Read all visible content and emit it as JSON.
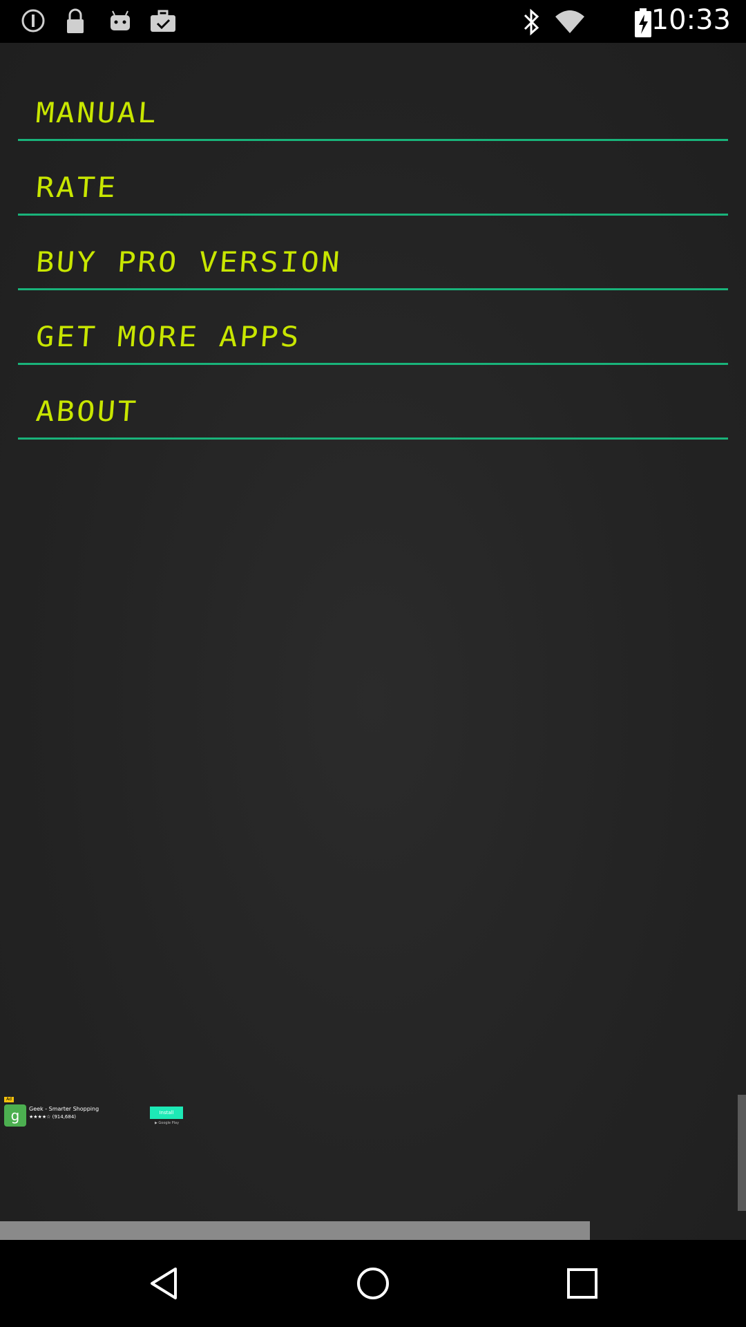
{
  "status_bar": {
    "time": "10:33",
    "icons_left": [
      "info-circle-icon",
      "lock-icon",
      "android-icon",
      "briefcase-check-icon"
    ],
    "icons_right": [
      "bluetooth-icon",
      "wifi-icon",
      "battery-charging-icon"
    ]
  },
  "menu": {
    "items": [
      {
        "label": "Manual"
      },
      {
        "label": "Rate"
      },
      {
        "label": "Buy Pro Version"
      },
      {
        "label": "Get More Apps"
      },
      {
        "label": "About"
      }
    ],
    "text_color": "#c8e600",
    "divider_color": "#19b37a"
  },
  "ad": {
    "badge": "Ad",
    "app_name": "Geek - Smarter Shopping",
    "rating": "★★★★☆ (914,684)",
    "install_label": "Install",
    "store_label": "▶ Google Play",
    "icon_letter": "g"
  },
  "nav_bar": {
    "buttons": [
      "back-triangle-icon",
      "home-circle-icon",
      "recents-square-icon"
    ]
  }
}
